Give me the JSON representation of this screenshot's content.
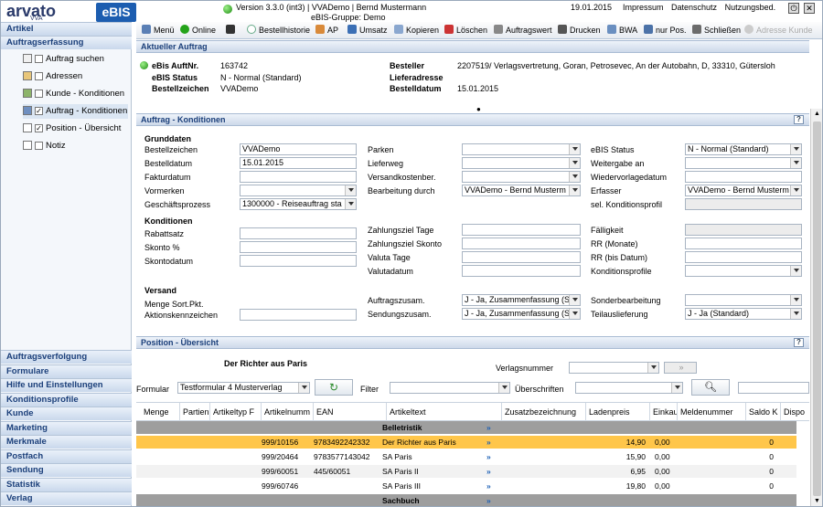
{
  "header": {
    "logo": "arvato",
    "logo_sub": "VVA",
    "app_name": "eBIS",
    "version": "Version 3.3.0 (int3) | VVADemo | Bernd Mustermann",
    "group": "eBIS-Gruppe: Demo",
    "date": "19.01.2015",
    "links": [
      "Impressum",
      "Datenschutz",
      "Nutzungsbed."
    ]
  },
  "sidebar": {
    "top_headers": [
      "Artikel",
      "Auftragserfassung"
    ],
    "tree": [
      {
        "label": "Auftrag suchen",
        "checked": false,
        "selected": false
      },
      {
        "label": "Adressen",
        "checked": false,
        "selected": false
      },
      {
        "label": "Kunde - Konditionen",
        "checked": false,
        "selected": false
      },
      {
        "label": "Auftrag - Konditionen",
        "checked": true,
        "selected": true
      },
      {
        "label": "Position - Übersicht",
        "checked": true,
        "selected": false
      },
      {
        "label": "Notiz",
        "checked": false,
        "selected": false
      }
    ],
    "bottom_headers": [
      "Auftragsverfolgung",
      "Formulare",
      "Hilfe und Einstellungen",
      "Konditionsprofile",
      "Kunde",
      "Marketing",
      "Merkmale",
      "Postfach",
      "Sendung",
      "Statistik",
      "Verlag"
    ]
  },
  "toolbar": {
    "items": [
      "Menü",
      "Online",
      "",
      "Bestellhistorie",
      "AP",
      "Umsatz",
      "Kopieren",
      "Löschen",
      "Auftragswert",
      "Drucken",
      "BWA",
      "nur Pos.",
      "Schließen",
      "Adresse Kunde"
    ]
  },
  "current_order": {
    "title": "Aktueller Auftrag",
    "fields": [
      {
        "label": "eBis AuftNr.",
        "value": "163742"
      },
      {
        "label": "eBIS Status",
        "value": "N - Normal (Standard)"
      },
      {
        "label": "Bestellzeichen",
        "value": "VVADemo"
      }
    ],
    "right": [
      {
        "label": "Besteller",
        "value": "2207519/ Verlagsvertretung, Goran, Petrosevec, An der Autobahn, D, 33310, Gütersloh"
      },
      {
        "label": "Lieferadresse",
        "value": ""
      },
      {
        "label": "Bestelldatum",
        "value": "15.01.2015"
      }
    ]
  },
  "conditions": {
    "title": "Auftrag - Konditionen",
    "grunddaten_title": "Grunddaten",
    "konditionen_title": "Konditionen",
    "versand_title": "Versand",
    "col1": [
      {
        "label": "Bestellzeichen",
        "value": "VVADemo",
        "type": "input"
      },
      {
        "label": "Bestelldatum",
        "value": "15.01.2015",
        "type": "input"
      },
      {
        "label": "Fakturdatum",
        "value": "",
        "type": "input"
      },
      {
        "label": "Vormerken",
        "value": "",
        "type": "select"
      },
      {
        "label": "Geschäftsprozess",
        "value": "1300000 - Reiseauftrag sta",
        "type": "select"
      }
    ],
    "col1k": [
      {
        "label": "Rabattsatz",
        "value": ""
      },
      {
        "label": "Skonto %",
        "value": ""
      },
      {
        "label": "Skontodatum",
        "value": ""
      }
    ],
    "col1v": [
      {
        "label": "Menge Sort.Pkt.",
        "value": ""
      },
      {
        "label": "Aktionskennzeichen",
        "value": ""
      }
    ],
    "col2": [
      {
        "label": "Parken",
        "value": "",
        "type": "select"
      },
      {
        "label": "Lieferweg",
        "value": "",
        "type": "select"
      },
      {
        "label": "Versandkostenber.",
        "value": "",
        "type": "select"
      },
      {
        "label": "Bearbeitung durch",
        "value": "VVADemo - Bernd Musterm",
        "type": "select"
      }
    ],
    "col2k": [
      {
        "label": "Zahlungsziel Tage",
        "value": ""
      },
      {
        "label": "Zahlungsziel Skonto",
        "value": ""
      },
      {
        "label": "Valuta Tage",
        "value": ""
      },
      {
        "label": "Valutadatum",
        "value": ""
      }
    ],
    "col2v": [
      {
        "label": "Auftragszusam.",
        "value": "J - Ja, Zusammenfassung (S"
      },
      {
        "label": "Sendungszusam.",
        "value": "J - Ja, Zusammenfassung (S"
      }
    ],
    "col3": [
      {
        "label": "eBIS Status",
        "value": "N - Normal (Standard)",
        "type": "select"
      },
      {
        "label": "Weitergabe an",
        "value": "",
        "type": "select"
      },
      {
        "label": "Wiedervorlagedatum",
        "value": "",
        "type": "input"
      },
      {
        "label": "Erfasser",
        "value": "VVADemo - Bernd Musterm",
        "type": "select"
      },
      {
        "label": "sel. Konditionsprofil",
        "value": "",
        "type": "ro"
      }
    ],
    "col3k": [
      {
        "label": "Fälligkeit",
        "value": "",
        "type": "ro"
      },
      {
        "label": "RR (Monate)",
        "value": "",
        "type": "input"
      },
      {
        "label": "RR (bis Datum)",
        "value": "",
        "type": "input"
      },
      {
        "label": "Konditionsprofile",
        "value": "",
        "type": "select"
      }
    ],
    "col3v": [
      {
        "label": "Sonderbearbeitung",
        "value": "",
        "type": "select"
      },
      {
        "label": "Teilauslieferung",
        "value": "J - Ja (Standard)",
        "type": "select"
      }
    ]
  },
  "positions": {
    "title": "Position - Übersicht",
    "book_title": "Der Richter aus Paris",
    "verlagsnummer_label": "Verlagsnummer",
    "verlagsnummer_value": "",
    "go_label": "»",
    "formular_label": "Formular",
    "formular_value": "Testformular 4 Musterverlag",
    "filter_label": "Filter",
    "ueberschriften_label": "Überschriften",
    "columns": [
      "Menge",
      "Partien",
      "Artikeltyp F",
      "Artikelnumm",
      "EAN",
      "Artikeltext",
      "Zusatzbezeichnung",
      "Ladenpreis",
      "Einkau",
      "Meldenummer",
      "Saldo K",
      "Dispo"
    ],
    "rows": [
      {
        "kind": "group",
        "text": "Belletristik"
      },
      {
        "kind": "sel",
        "artnr": "999/10156",
        "ean": "9783492242332",
        "text": "Der Richter aus Paris",
        "preis": "14,90",
        "ek": "0,00",
        "saldo": "0"
      },
      {
        "kind": "row",
        "artnr": "999/20464",
        "ean": "9783577143042",
        "text": "SA Paris",
        "preis": "15,90",
        "ek": "0,00",
        "saldo": "0"
      },
      {
        "kind": "alt",
        "artnr": "999/60051",
        "ean": "445/60051",
        "text": "SA Paris II",
        "preis": "6,95",
        "ek": "0,00",
        "saldo": "0"
      },
      {
        "kind": "row",
        "artnr": "999/60746",
        "ean": "",
        "text": "SA Paris III",
        "preis": "19,80",
        "ek": "0,00",
        "saldo": "0"
      },
      {
        "kind": "group",
        "text": "Sachbuch"
      }
    ],
    "link_glyph": "»"
  },
  "colors": {
    "accent": "#1c5db0",
    "section": "#1b3f7a",
    "selected_row": "#ffc64a",
    "group_row": "#9e9e9e"
  }
}
